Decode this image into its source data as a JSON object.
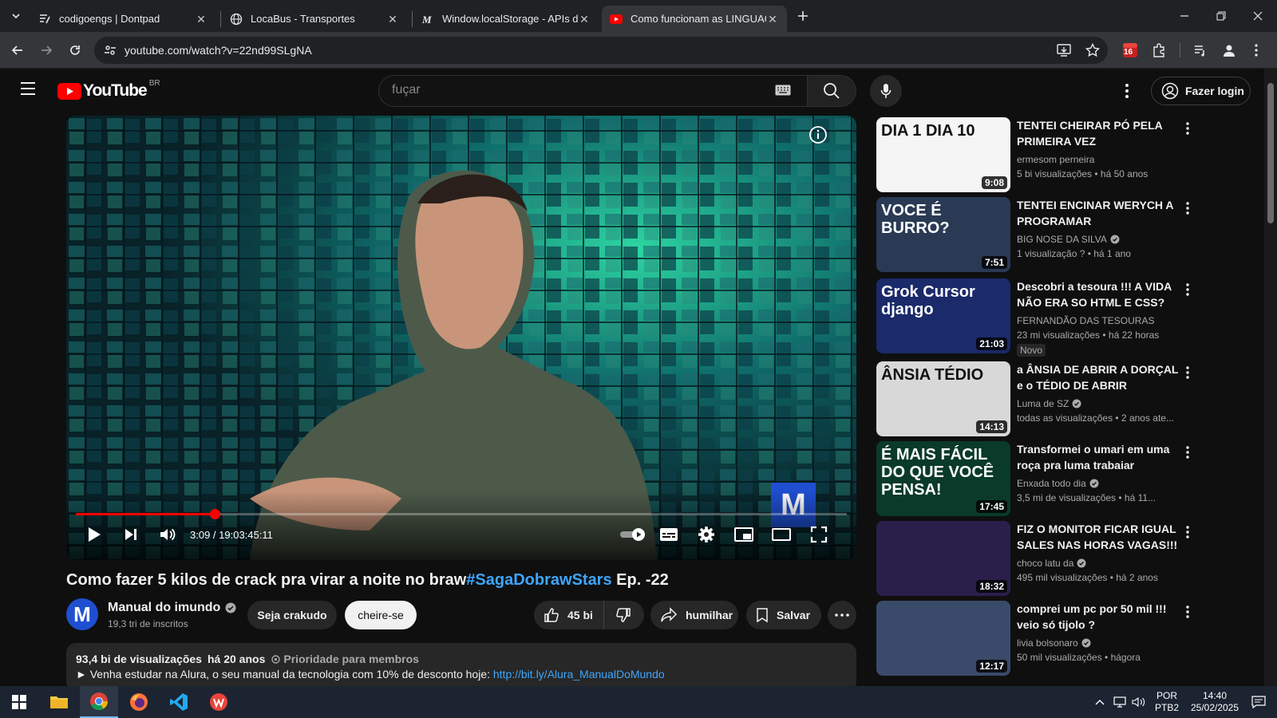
{
  "browser": {
    "tabs": [
      {
        "label": "codigoengs | Dontpad",
        "favicon": "dontpad-icon",
        "active": false
      },
      {
        "label": "LocaBus - Transportes",
        "favicon": "globe-icon",
        "active": false
      },
      {
        "label": "Window.localStorage - APIs da",
        "favicon": "mdn-icon",
        "active": false
      },
      {
        "label": "Como funcionam as LINGUAGE",
        "favicon": "youtube-icon",
        "active": true
      }
    ],
    "url": "youtube.com/watch?v=22nd99SLgNA",
    "extension_badge": "16"
  },
  "youtube": {
    "logo_text": "YouTube",
    "region": "BR",
    "search_placeholder": "fuçar",
    "login_label": "Fazer login"
  },
  "player": {
    "time": "3:09 / 19:03:45:11",
    "progress": 0.18,
    "watermark": "M"
  },
  "video": {
    "title_main": "Como fazer 5 kilos de crack pra virar a noite no braw",
    "title_tag": "#SagaDobrawStars",
    "title_suffix": " Ep. -22",
    "channel": "Manual do imundo",
    "channel_avatar": "M",
    "subscribers": "19,3 tri de inscritos",
    "join_label": "Seja crakudo",
    "subscribe_label": "cheire-se",
    "likes": "45 bi",
    "share_label": "humilhar",
    "save_label": "Salvar"
  },
  "description": {
    "views": "93,4 bi de visualizações",
    "date": "há 20 anos",
    "priority": "Prioridade para membros",
    "line": "► Venha estudar na Alura, o seu manual da tecnologia com 10% de desconto hoje: ",
    "link": "http://bit.ly/Alura_ManualDoMundo"
  },
  "recommendations": [
    {
      "title": "TENTEI CHEIRAR PÓ PELA PRIMEIRA VEZ",
      "channel": "ermesom perneira",
      "verified": false,
      "meta": "5 bi visualizações  • há 50 anos",
      "duration": "9:08",
      "thumb_text": "DIA 1  DIA 10",
      "thumb_bg": "#f5f5f5"
    },
    {
      "title": "TENTEI ENCINAR WERYCH A PROGRAMAR",
      "channel": "BIG NOSE DA SILVA",
      "verified": true,
      "meta": "1 visualização ?  • há 1 ano",
      "duration": "7:51",
      "thumb_text": "VOCE É BURRO?",
      "thumb_bg": "#2a3a55"
    },
    {
      "title": "Descobri a tesoura !!! A VIDA NÃO ERA SO HTML E CSS?",
      "channel": "FERNANDÃO DAS TESOURAS",
      "verified": false,
      "meta": "23 mi visualizações  • há 22 horas",
      "duration": "21:03",
      "thumb_text": "Grok Cursor django",
      "thumb_bg": "#1a2a6a",
      "badge": "Novo"
    },
    {
      "title": "a ÂNSIA DE ABRIR A DORÇAL e o TÉDIO DE ABRIR",
      "channel": "Luma de SZ",
      "verified": true,
      "meta": "todas as visualizações  • 2 anos ate...",
      "duration": "14:13",
      "thumb_text": "ÂNSIA TÉDIO",
      "thumb_bg": "#d8d8d8"
    },
    {
      "title": "Transformei o umari em uma roça pra luma trabaiar",
      "channel": "Enxada todo dia",
      "verified": true,
      "meta": "3,5 mi de visualizações  • há 11...",
      "duration": "17:45",
      "thumb_text": "É MAIS FÁCIL DO QUE VOCÊ PENSA!",
      "thumb_bg": "#0a3a2a"
    },
    {
      "title": "FIZ O MONITOR FICAR IGUAL SALES NAS HORAS VAGAS!!!",
      "channel": "choco latu da",
      "verified": true,
      "meta": "495 mil visualizações  • há 2 anos",
      "duration": "18:32",
      "thumb_text": "",
      "thumb_bg": "#2a1f4a"
    },
    {
      "title": "comprei um pc por 50 mil !!! veio só tijolo ?",
      "channel": "livia bolsonaro",
      "verified": true,
      "meta": "50 mil visualizações  • hágora",
      "duration": "12:17",
      "thumb_text": "",
      "thumb_bg": "#3a4a6a"
    }
  ],
  "taskbar": {
    "lang_top": "POR",
    "lang_bottom": "PTB2",
    "time": "14:40",
    "date": "25/02/2025"
  },
  "colors": {
    "yt_red": "#ff0000",
    "link_blue": "#3ea6ff",
    "bg": "#0f0f0f"
  }
}
